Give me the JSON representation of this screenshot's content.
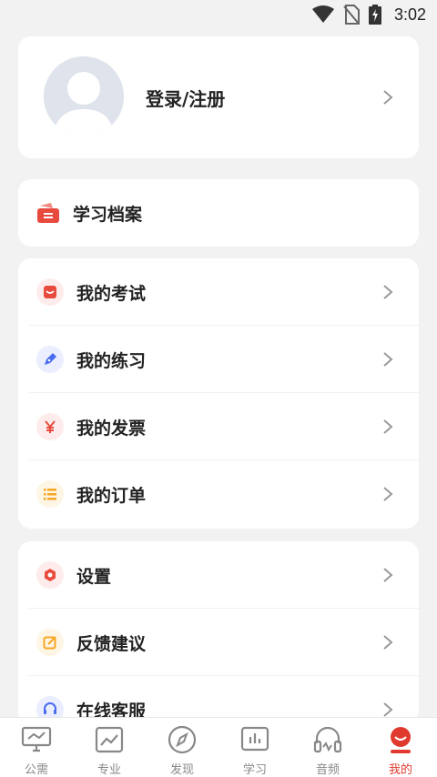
{
  "status_bar": {
    "time": "3:02"
  },
  "profile": {
    "login_label": "登录/注册"
  },
  "archive": {
    "label": "学习档案"
  },
  "menu_group_1": [
    {
      "label": "我的考试",
      "icon": "exam-icon",
      "color": "#e84a3d",
      "bg": "#fdeceb"
    },
    {
      "label": "我的练习",
      "icon": "practice-icon",
      "color": "#4a6cf0",
      "bg": "#eaeefe"
    },
    {
      "label": "我的发票",
      "icon": "invoice-icon",
      "color": "#e84a3d",
      "bg": "#fdeceb"
    },
    {
      "label": "我的订单",
      "icon": "order-icon",
      "color": "#f5a623",
      "bg": "#fef5e5"
    }
  ],
  "menu_group_2": [
    {
      "label": "设置",
      "icon": "settings-icon",
      "color": "#e84a3d",
      "bg": "#fdeceb"
    },
    {
      "label": "反馈建议",
      "icon": "feedback-icon",
      "color": "#f5a623",
      "bg": "#fef5e5"
    },
    {
      "label": "在线客服",
      "icon": "customer-service-icon",
      "color": "#4a6cf0",
      "bg": "#eaeefe"
    }
  ],
  "bottom_nav": [
    {
      "label": "公需",
      "icon": "monitor-icon",
      "active": false
    },
    {
      "label": "专业",
      "icon": "trend-icon",
      "active": false
    },
    {
      "label": "发现",
      "icon": "compass-icon",
      "active": false
    },
    {
      "label": "学习",
      "icon": "study-icon",
      "active": false
    },
    {
      "label": "音频",
      "icon": "headphones-icon",
      "active": false
    },
    {
      "label": "我的",
      "icon": "profile-icon",
      "active": true
    }
  ],
  "colors": {
    "accent": "#e03a2f",
    "background": "#f2f2f2",
    "card": "#ffffff"
  }
}
